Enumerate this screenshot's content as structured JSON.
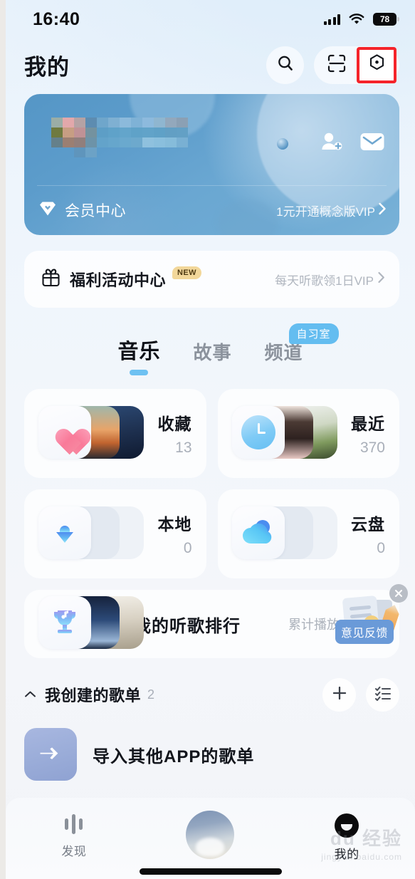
{
  "status_bar": {
    "time": "16:40",
    "battery_level": "78",
    "signal_icon": "signal-bars-icon",
    "wifi_icon": "wifi-icon",
    "battery_icon": "battery-icon"
  },
  "header": {
    "title": "我的",
    "search_icon": "search-icon",
    "scan_icon": "scan-icon",
    "settings_icon": "settings-hexagon-icon",
    "highlight_color": "#f5242a"
  },
  "profile_card": {
    "nickname_masked": "",
    "subtitle_masked": "",
    "add_friend_icon": "add-friend-icon",
    "message_icon": "mail-icon",
    "vip_icon": "vip-diamond-icon",
    "vip_label": "会员中心",
    "vip_promo": "1元开通概念版VIP",
    "chevron": "›"
  },
  "welfare": {
    "gift_icon": "gift-icon",
    "title": "福利活动中心",
    "badge": "NEW",
    "badge_color": "#f2d79a",
    "subtitle": "每天听歌领1日VIP",
    "chevron": "›"
  },
  "tabs": [
    {
      "label": "音乐",
      "active": true,
      "badge": null
    },
    {
      "label": "故事",
      "active": false,
      "badge": null
    },
    {
      "label": "频道",
      "active": false,
      "badge": "自习室"
    }
  ],
  "tab_badge_color": "#64bdf0",
  "grid_cards": [
    {
      "name": "收藏",
      "count": "13",
      "icon": "heart-icon"
    },
    {
      "name": "最近",
      "count": "370",
      "icon": "clock-icon"
    },
    {
      "name": "本地",
      "count": "0",
      "icon": "download-icon"
    },
    {
      "name": "云盘",
      "count": "0",
      "icon": "cloud-icon"
    }
  ],
  "rank_row": {
    "icon": "trophy-music-icon",
    "title": "我的听歌排行",
    "subtitle": "累计播放609首",
    "chevron": "›"
  },
  "feedback_widget": {
    "label": "意见反馈",
    "close_icon": "close-icon",
    "coin_symbol": "#",
    "label_color": "#6a9ad8"
  },
  "created_playlists": {
    "caret_icon": "chevron-up-icon",
    "title": "我创建的歌单",
    "count": "2",
    "add_icon": "plus-icon",
    "manage_icon": "list-manage-icon",
    "import_row": {
      "icon": "import-arrow-icon",
      "label": "导入其他APP的歌单"
    }
  },
  "bottom_nav": [
    {
      "label": "发现",
      "icon": "waveform-icon",
      "active": false
    },
    {
      "label": "",
      "icon": "album-art-icon",
      "active": false
    },
    {
      "label": "我的",
      "icon": "avatar-icon",
      "active": true
    }
  ],
  "watermark": {
    "main": "du 经验",
    "sub": "jingyan.baidu.com"
  }
}
